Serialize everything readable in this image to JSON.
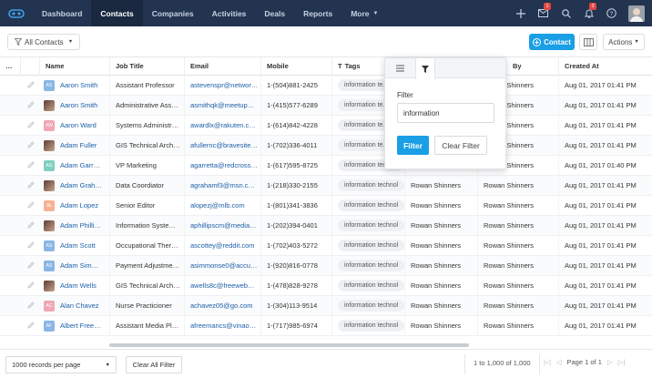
{
  "nav": {
    "items": [
      {
        "label": "Dashboard"
      },
      {
        "label": "Contacts",
        "active": true
      },
      {
        "label": "Companies"
      },
      {
        "label": "Activities"
      },
      {
        "label": "Deals"
      },
      {
        "label": "Reports"
      },
      {
        "label": "More"
      }
    ],
    "mail_badge": "1",
    "notif_badge": "3"
  },
  "toolbar": {
    "view_label": "All Contacts",
    "add_label": "Contact",
    "actions_label": "Actions"
  },
  "columns": {
    "name": "Name",
    "job": "Job Title",
    "email": "Email",
    "mobile": "Mobile",
    "tags": "Tags",
    "created_by": "By",
    "created_at": "Created At"
  },
  "rows": [
    {
      "initials": "AS",
      "photo": false,
      "color": "#8ab6e6",
      "name": "Aaron Smith",
      "job": "Assistant Professor",
      "email": "astevenspr@networ…",
      "mobile": "1-(504)881-2425",
      "tag": "information te…",
      "owner": "",
      "created_by": "Rowan Shinners",
      "created_at": "Aug 01, 2017 01:41 PM"
    },
    {
      "initials": "",
      "photo": true,
      "color": "",
      "name": "Aaron Smith",
      "job": "Administrative Ass…",
      "email": "asmithqk@meetup…",
      "mobile": "1-(415)577-6289",
      "tag": "information te…",
      "owner": "",
      "created_by": "Rowan Shinners",
      "created_at": "Aug 01, 2017 01:41 PM"
    },
    {
      "initials": "AW",
      "photo": false,
      "color": "#f0a6b4",
      "name": "Aaron Ward",
      "job": "Systems Administr…",
      "email": "awardlx@rakuten.c…",
      "mobile": "1-(614)842-4228",
      "tag": "information te…",
      "owner": "",
      "created_by": "Rowan Shinners",
      "created_at": "Aug 01, 2017 01:41 PM"
    },
    {
      "initials": "",
      "photo": true,
      "color": "",
      "name": "Adam Fuller",
      "job": "GIS Technical Arch…",
      "email": "afullernc@bravesite…",
      "mobile": "1-(702)336-4011",
      "tag": "information te…",
      "owner": "",
      "created_by": "Rowan Shinners",
      "created_at": "Aug 01, 2017 01:41 PM"
    },
    {
      "initials": "AG",
      "photo": false,
      "color": "#7ecfc0",
      "name": "Adam Garr…",
      "job": "VP Marketing",
      "email": "agarretta@redcross…",
      "mobile": "1-(617)595-8725",
      "tag": "information technol",
      "owner": "",
      "created_by": "Rowan Shinners",
      "created_at": "Aug 01, 2017 01:40 PM"
    },
    {
      "initials": "",
      "photo": true,
      "color": "",
      "name": "Adam Grah…",
      "job": "Data Coordiator",
      "email": "agrahamf3@msn.c…",
      "mobile": "1-(218)330-2155",
      "tag": "information technol",
      "owner": "Rowan Shinners",
      "created_by": "Rowan Shinners",
      "created_at": "Aug 01, 2017 01:41 PM"
    },
    {
      "initials": "AL",
      "photo": false,
      "color": "#f6b294",
      "name": "Adam Lopez",
      "job": "Senior Editor",
      "email": "alopezj@mlb.com",
      "mobile": "1-(801)341-3836",
      "tag": "information technol",
      "owner": "Rowan Shinners",
      "created_by": "Rowan Shinners",
      "created_at": "Aug 01, 2017 01:41 PM"
    },
    {
      "initials": "",
      "photo": true,
      "color": "",
      "name": "Adam Philli…",
      "job": "Information Syste…",
      "email": "aphillipscm@media…",
      "mobile": "1-(202)394-0401",
      "tag": "information technol",
      "owner": "Rowan Shinners",
      "created_by": "Rowan Shinners",
      "created_at": "Aug 01, 2017 01:41 PM"
    },
    {
      "initials": "AS",
      "photo": false,
      "color": "#8ab6e6",
      "name": "Adam Scott",
      "job": "Occupational Ther…",
      "email": "ascottey@reddit.com",
      "mobile": "1-(702)403-5272",
      "tag": "information technol",
      "owner": "Rowan Shinners",
      "created_by": "Rowan Shinners",
      "created_at": "Aug 01, 2017 01:41 PM"
    },
    {
      "initials": "AS",
      "photo": false,
      "color": "#8ab6e6",
      "name": "Adam Sim…",
      "job": "Payment Adjustme…",
      "email": "asimmonse0@accu…",
      "mobile": "1-(920)816-0778",
      "tag": "information technol",
      "owner": "Rowan Shinners",
      "created_by": "Rowan Shinners",
      "created_at": "Aug 01, 2017 01:41 PM"
    },
    {
      "initials": "",
      "photo": true,
      "color": "",
      "name": "Adam Wells",
      "job": "GIS Technical Arch…",
      "email": "awells8c@freeweb…",
      "mobile": "1-(478)828-9278",
      "tag": "information technol",
      "owner": "Rowan Shinners",
      "created_by": "Rowan Shinners",
      "created_at": "Aug 01, 2017 01:41 PM"
    },
    {
      "initials": "AC",
      "photo": false,
      "color": "#f0a6b4",
      "name": "Alan Chavez",
      "job": "Nurse Practicioner",
      "email": "achavez05@go.com",
      "mobile": "1-(304)113-9514",
      "tag": "information technol",
      "owner": "Rowan Shinners",
      "created_by": "Rowan Shinners",
      "created_at": "Aug 01, 2017 01:41 PM"
    },
    {
      "initials": "AF",
      "photo": false,
      "color": "#8ab6e6",
      "name": "Albert Free…",
      "job": "Assistant Media Pl…",
      "email": "afreemancs@vinao…",
      "mobile": "1-(717)985-6974",
      "tag": "information technol",
      "owner": "Rowan Shinners",
      "created_by": "Rowan Shinners",
      "created_at": "Aug 01, 2017 01:41 PM"
    }
  ],
  "filter_popup": {
    "label": "Filter",
    "value": "information",
    "filter_btn": "Filter",
    "clear_btn": "Clear Filter"
  },
  "footer": {
    "per_page": "1000 records per page",
    "clear_all": "Clear All Filter",
    "record_count": "1 to 1,000 of 1,000",
    "page_info": "Page 1 of 1"
  }
}
